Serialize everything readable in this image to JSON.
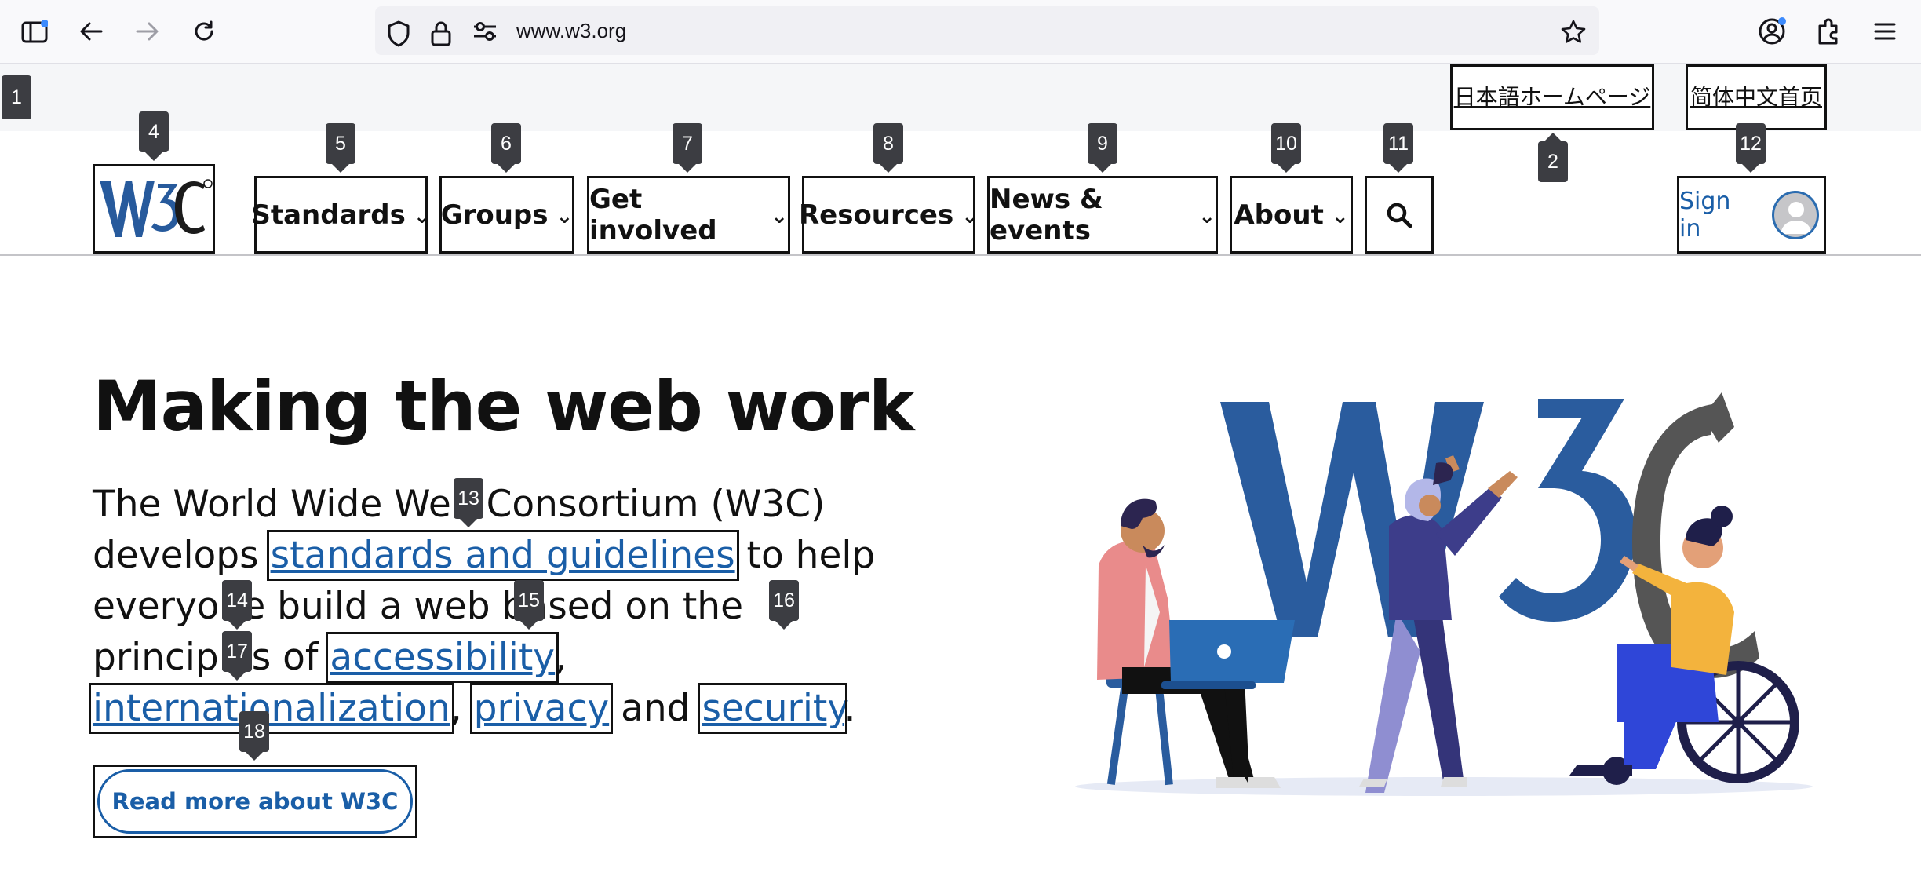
{
  "browser": {
    "url": "www.w3.org",
    "icons": [
      "sidebar-icon",
      "back-icon",
      "forward-icon",
      "reload-icon",
      "shield-icon",
      "lock-icon",
      "permissions-icon",
      "bookmark-star-icon",
      "account-icon",
      "extensions-icon",
      "menu-icon"
    ]
  },
  "lang_links": {
    "japanese": "日本語ホームページ",
    "chinese": "简体中文首页"
  },
  "nav": {
    "standards": "Standards",
    "groups": "Groups",
    "get_involved": "Get involved",
    "resources": "Resources",
    "news_events": "News & events",
    "about": "About",
    "sign_in": "Sign in"
  },
  "hero": {
    "title": "Making the web work",
    "lead_1": "The World Wide Web Consortium (W3C) develops",
    "link_standards": "standards and guidelines",
    "lead_2": "to help everyone build a web based on the principles of",
    "link_accessibility": "accessibility",
    "sep_1": ",",
    "link_i18n": "internationalization",
    "sep_2": ",",
    "link_privacy": "privacy",
    "lead_3": "and",
    "link_security": "security",
    "lead_4": ".",
    "cta": "Read more about W3C"
  },
  "markers": [
    "1",
    "2",
    "4",
    "5",
    "6",
    "7",
    "8",
    "9",
    "10",
    "11",
    "12",
    "13",
    "14",
    "15",
    "16",
    "17",
    "18"
  ],
  "colors": {
    "w3c_blue": "#1a5ea7",
    "logo_blue": "#275a9c",
    "text": "#111111",
    "marker_bg": "#3c3d42"
  }
}
